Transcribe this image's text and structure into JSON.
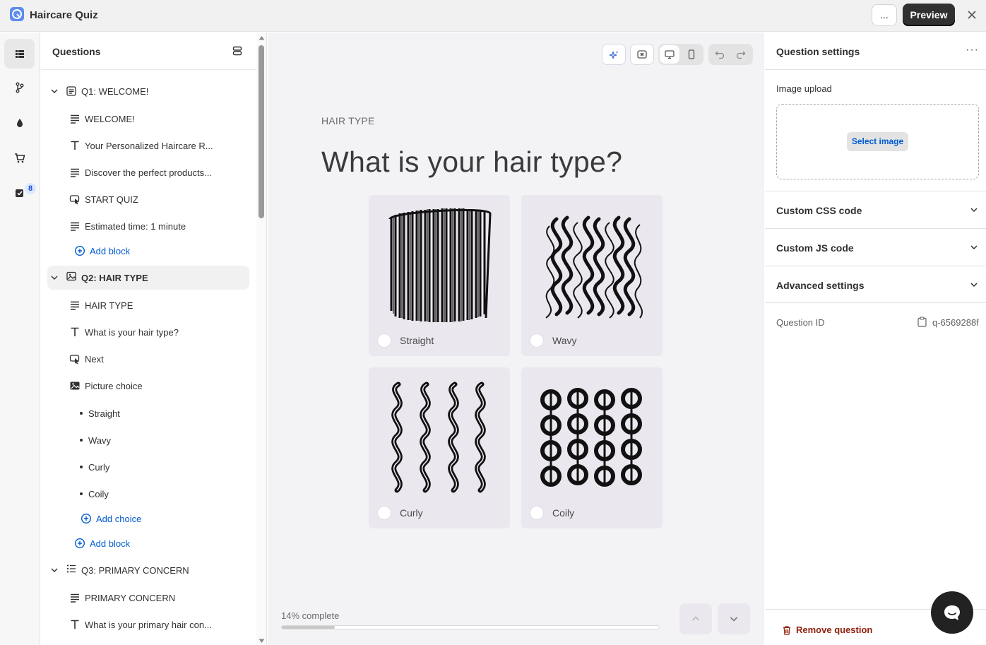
{
  "app": {
    "title": "Haircare Quiz"
  },
  "topbar": {
    "more_label": "...",
    "preview_label": "Preview"
  },
  "rail": {
    "badge_count": "8"
  },
  "questions_panel": {
    "title": "Questions",
    "q1": {
      "label": "Q1: WELCOME!",
      "blocks": [
        "WELCOME!",
        "Your Personalized Haircare R...",
        "Discover the perfect products...",
        "START QUIZ",
        "Estimated time: 1 minute"
      ],
      "add_block": "Add block"
    },
    "q2": {
      "label": "Q2: HAIR TYPE",
      "blocks": [
        "HAIR TYPE",
        "What is your hair type?",
        "Next",
        "Picture choice"
      ],
      "choices": [
        "Straight",
        "Wavy",
        "Curly",
        "Coily"
      ],
      "add_choice": "Add choice",
      "add_block": "Add block"
    },
    "q3": {
      "label": "Q3: PRIMARY CONCERN",
      "blocks": [
        "PRIMARY CONCERN",
        "What is your primary hair con..."
      ]
    }
  },
  "canvas": {
    "eyebrow": "HAIR TYPE",
    "title": "What is your hair type?",
    "choices": [
      {
        "label": "Straight",
        "art": "straight-hair-icon"
      },
      {
        "label": "Wavy",
        "art": "wavy-hair-icon"
      },
      {
        "label": "Curly",
        "art": "curly-hair-icon"
      },
      {
        "label": "Coily",
        "art": "coily-hair-icon"
      }
    ],
    "progress": {
      "label": "14% complete",
      "percent": 14
    }
  },
  "settings": {
    "title": "Question settings",
    "more_label": "···",
    "image_upload_label": "Image upload",
    "select_image_label": "Select image",
    "accordions": [
      "Custom CSS code",
      "Custom JS code",
      "Advanced settings"
    ],
    "question_id_label": "Question ID",
    "question_id_value": "q-6569288f",
    "remove_label": "Remove question"
  },
  "colors": {
    "accent": "#005bd3",
    "danger": "#8e1f0b",
    "choice_bg": "#ebe7ef",
    "canvas_bg": "#f3f2f5"
  }
}
